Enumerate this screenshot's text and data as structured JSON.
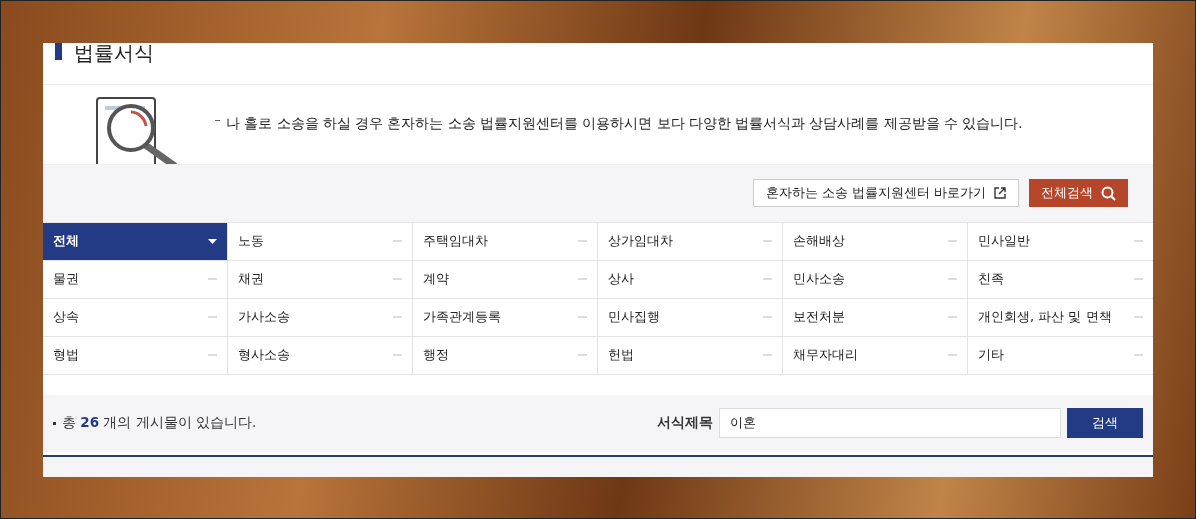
{
  "page_title": "법률서식",
  "intro": {
    "text": "나 홀로 소송을 하실 경우 혼자하는 소송 법률지원센터를 이용하시면 보다 다양한 법률서식과 상담사례를 제공받을 수 있습니다."
  },
  "actions": [
    {
      "kind": "link",
      "label": "혼자하는 소송 법률지원센터 바로가기"
    },
    {
      "kind": "search",
      "label": "전체검색"
    }
  ],
  "categories": [
    {
      "label": "전체",
      "selected": true
    },
    {
      "label": "노동",
      "selected": false
    },
    {
      "label": "주택임대차",
      "selected": false
    },
    {
      "label": "상가임대차",
      "selected": false
    },
    {
      "label": "손해배상",
      "selected": false
    },
    {
      "label": "민사일반",
      "selected": false
    },
    {
      "label": "물권",
      "selected": false
    },
    {
      "label": "채권",
      "selected": false
    },
    {
      "label": "계약",
      "selected": false
    },
    {
      "label": "상사",
      "selected": false
    },
    {
      "label": "민사소송",
      "selected": false
    },
    {
      "label": "친족",
      "selected": false
    },
    {
      "label": "상속",
      "selected": false
    },
    {
      "label": "가사소송",
      "selected": false
    },
    {
      "label": "가족관계등록",
      "selected": false
    },
    {
      "label": "민사집행",
      "selected": false
    },
    {
      "label": "보전처분",
      "selected": false
    },
    {
      "label": "개인회생, 파산 및 면책",
      "selected": false
    },
    {
      "label": "형법",
      "selected": false
    },
    {
      "label": "형사소송",
      "selected": false
    },
    {
      "label": "행정",
      "selected": false
    },
    {
      "label": "헌법",
      "selected": false
    },
    {
      "label": "채무자대리",
      "selected": false
    },
    {
      "label": "기타",
      "selected": false
    }
  ],
  "result": {
    "summary": "총 **26** 개의 게시물이 있습니다.",
    "search_label": "서식제목",
    "search_value": "이혼",
    "search_button": "검색"
  }
}
